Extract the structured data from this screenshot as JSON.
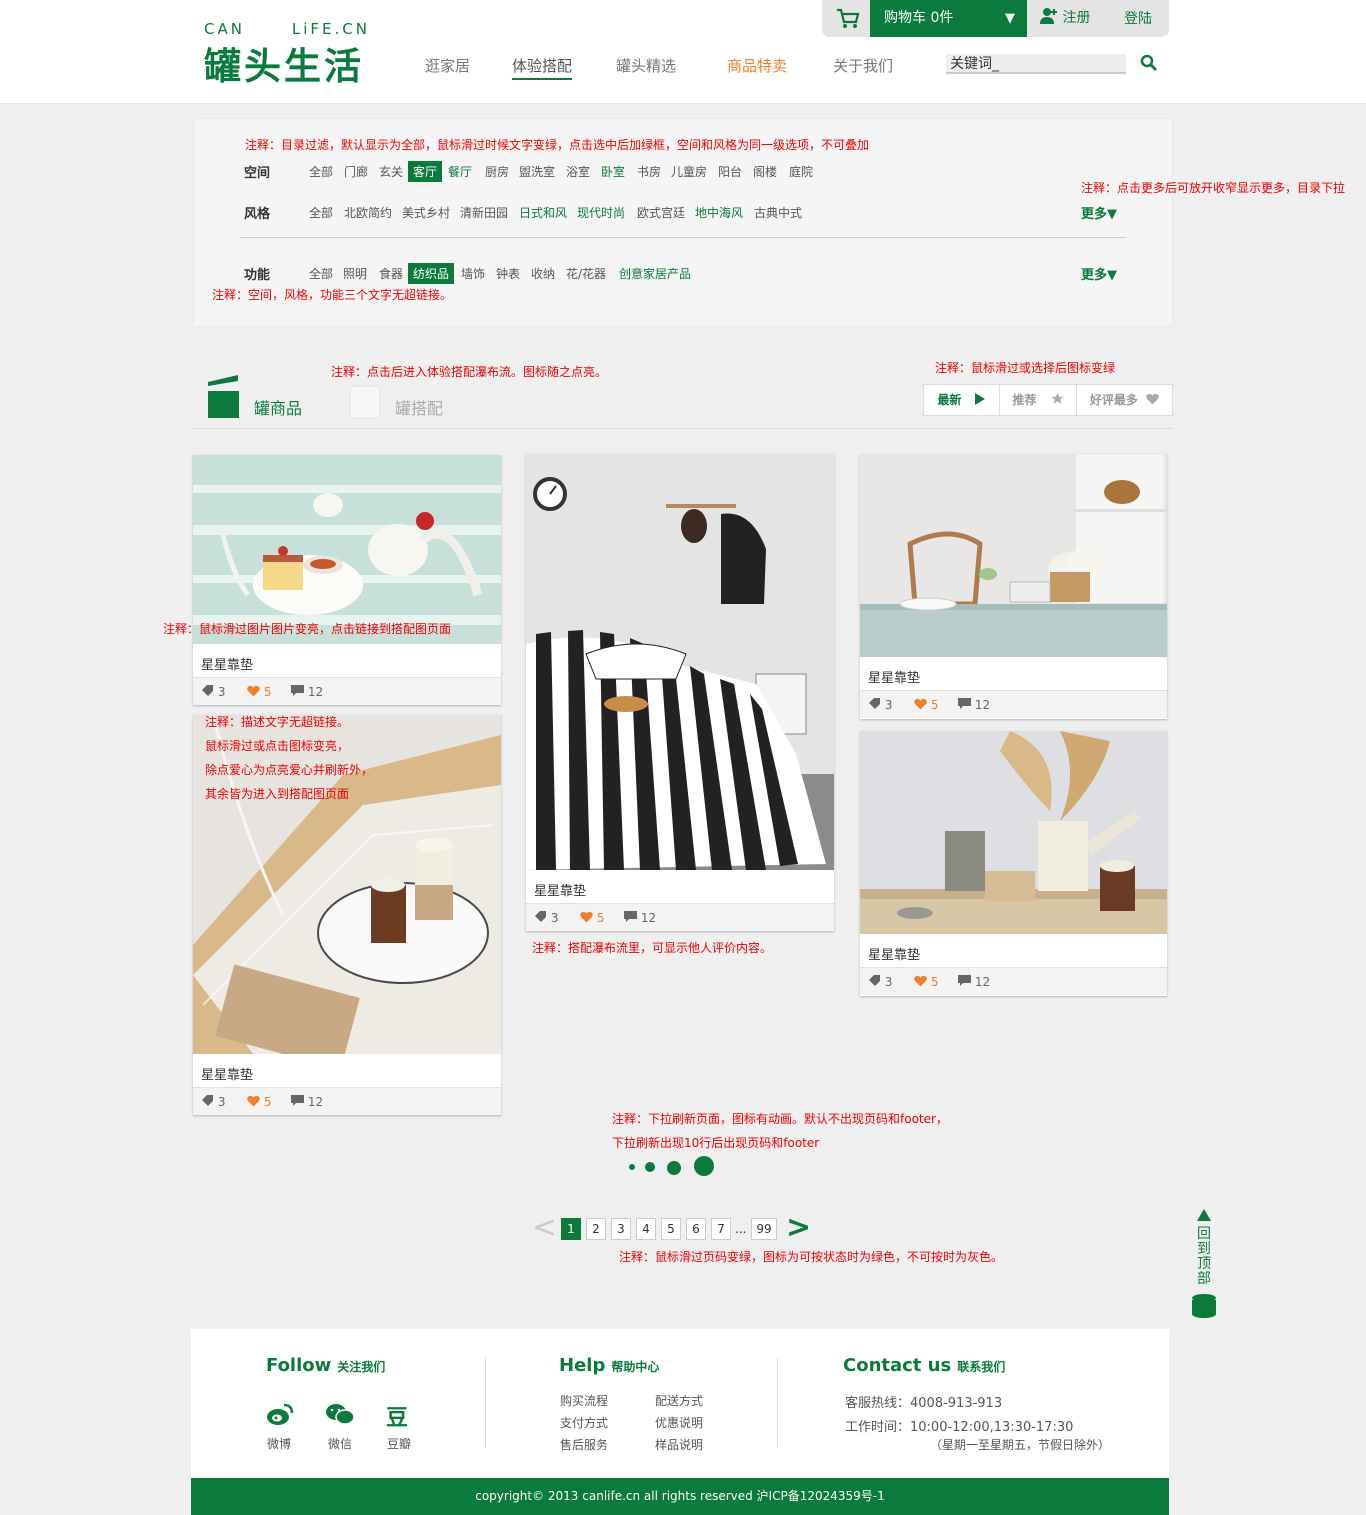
{
  "header": {
    "logo_en_left": "CAN",
    "logo_en_right": "LiFE.CN",
    "logo_cn": "罐头生活",
    "nav": [
      "逛家居",
      "体验搭配",
      "罐头精选",
      "商品特卖",
      "关于我们"
    ],
    "search_placeholder": "关键词_",
    "cart_label": "购物车 0件",
    "cart_arrow": "▼",
    "register": "注册",
    "login": "登陆"
  },
  "filter": {
    "space_label": "空间",
    "space_options": [
      "全部",
      "门廊",
      "玄关",
      "客厅",
      "餐厅",
      "厨房",
      "盥洗室",
      "浴室",
      "卧室",
      "书房",
      "儿童房",
      "阳台",
      "阁楼",
      "庭院"
    ],
    "style_label": "风格",
    "style_options": [
      "全部",
      "北欧简约",
      "美式乡村",
      "清新田园",
      "日式和风",
      "现代时尚",
      "欧式宫廷",
      "地中海风",
      "古典中式"
    ],
    "func_label": "功能",
    "func_options": [
      "全部",
      "照明",
      "食器",
      "纺织品",
      "墙饰",
      "钟表",
      "收纳",
      "花/花器",
      "创意家居产品"
    ],
    "more_label": "更多▼"
  },
  "tabs": {
    "goods": "罐商品",
    "match": "罐搭配"
  },
  "sort": {
    "newest": "最新",
    "recommend": "推荐",
    "best": "好评最多"
  },
  "cards": [
    {
      "title": "星星靠垫",
      "tags": "3",
      "likes": "5",
      "comments": "12"
    },
    {
      "title": "星星靠垫",
      "tags": "3",
      "likes": "5",
      "comments": "12"
    },
    {
      "title": "星星靠垫",
      "tags": "3",
      "likes": "5",
      "comments": "12"
    },
    {
      "title": "星星靠垫",
      "tags": "3",
      "likes": "5",
      "comments": "12"
    },
    {
      "title": "星星靠垫",
      "tags": "3",
      "likes": "5",
      "comments": "12"
    }
  ],
  "notes": {
    "n1": "注释：目录过滤，默认显示为全部，鼠标滑过时候文字变绿，点击选中后加绿框，空间和风格为同一级选项，不可叠加",
    "n2": "注释：点击更多后可放开收窄显示更多，目录下拉",
    "n3": "注释：空间，风格，功能三个文字无超链接。",
    "n4": "注释：点击后进入体验搭配瀑布流。图标随之点亮。",
    "n5": "注释：鼠标滑过或选择后图标变绿",
    "n6": "注释：鼠标滑过图片图片变亮，点击链接到搭配图页面",
    "n7a": "注释：描述文字无超链接。",
    "n7b": "鼠标滑过或点击图标变亮，",
    "n7c": "除点爱心为点亮爱心并刷新外，",
    "n7d": "其余皆为进入到搭配图页面",
    "n8": "注释：搭配瀑布流里，可显示他人评价内容。",
    "n9a": "注释：下拉刷新页面，图标有动画。默认不出现页码和footer，",
    "n9b": "下拉刷新出现10行后出现页码和footer",
    "n10": "注释：鼠标滑过页码变绿，图标为可按状态时为绿色，不可按时为灰色。"
  },
  "pagination": {
    "prev": "<",
    "pages": [
      "1",
      "2",
      "3",
      "4",
      "5",
      "6",
      "7"
    ],
    "ellipsis": "...",
    "last": "99",
    "next": ">"
  },
  "back_to_top": [
    "回",
    "到",
    "顶",
    "部"
  ],
  "footer": {
    "follow_en": "Follow",
    "follow_cn": "关注我们",
    "weibo": "微博",
    "wechat": "微信",
    "douban": "豆瓣",
    "douban_glyph": "豆",
    "help_en": "Help",
    "help_cn": "帮助中心",
    "help_links": [
      "购买流程",
      "配送方式",
      "支付方式",
      "优惠说明",
      "售后服务",
      "样品说明"
    ],
    "contact_en": "Contact us",
    "contact_cn": "联系我们",
    "hotline": "客服热线：4008-913-913",
    "hours": "工作时间：10:00-12:00,13:30-17:30",
    "hours_note": "（星期一至星期五，节假日除外）",
    "copyright": "copyright© 2013 canlife.cn all rights reserved    沪ICP备12024359号-1"
  },
  "colors": {
    "brand": "#0a7b3c",
    "accent": "#ee7f2b",
    "note": "#e00000"
  }
}
